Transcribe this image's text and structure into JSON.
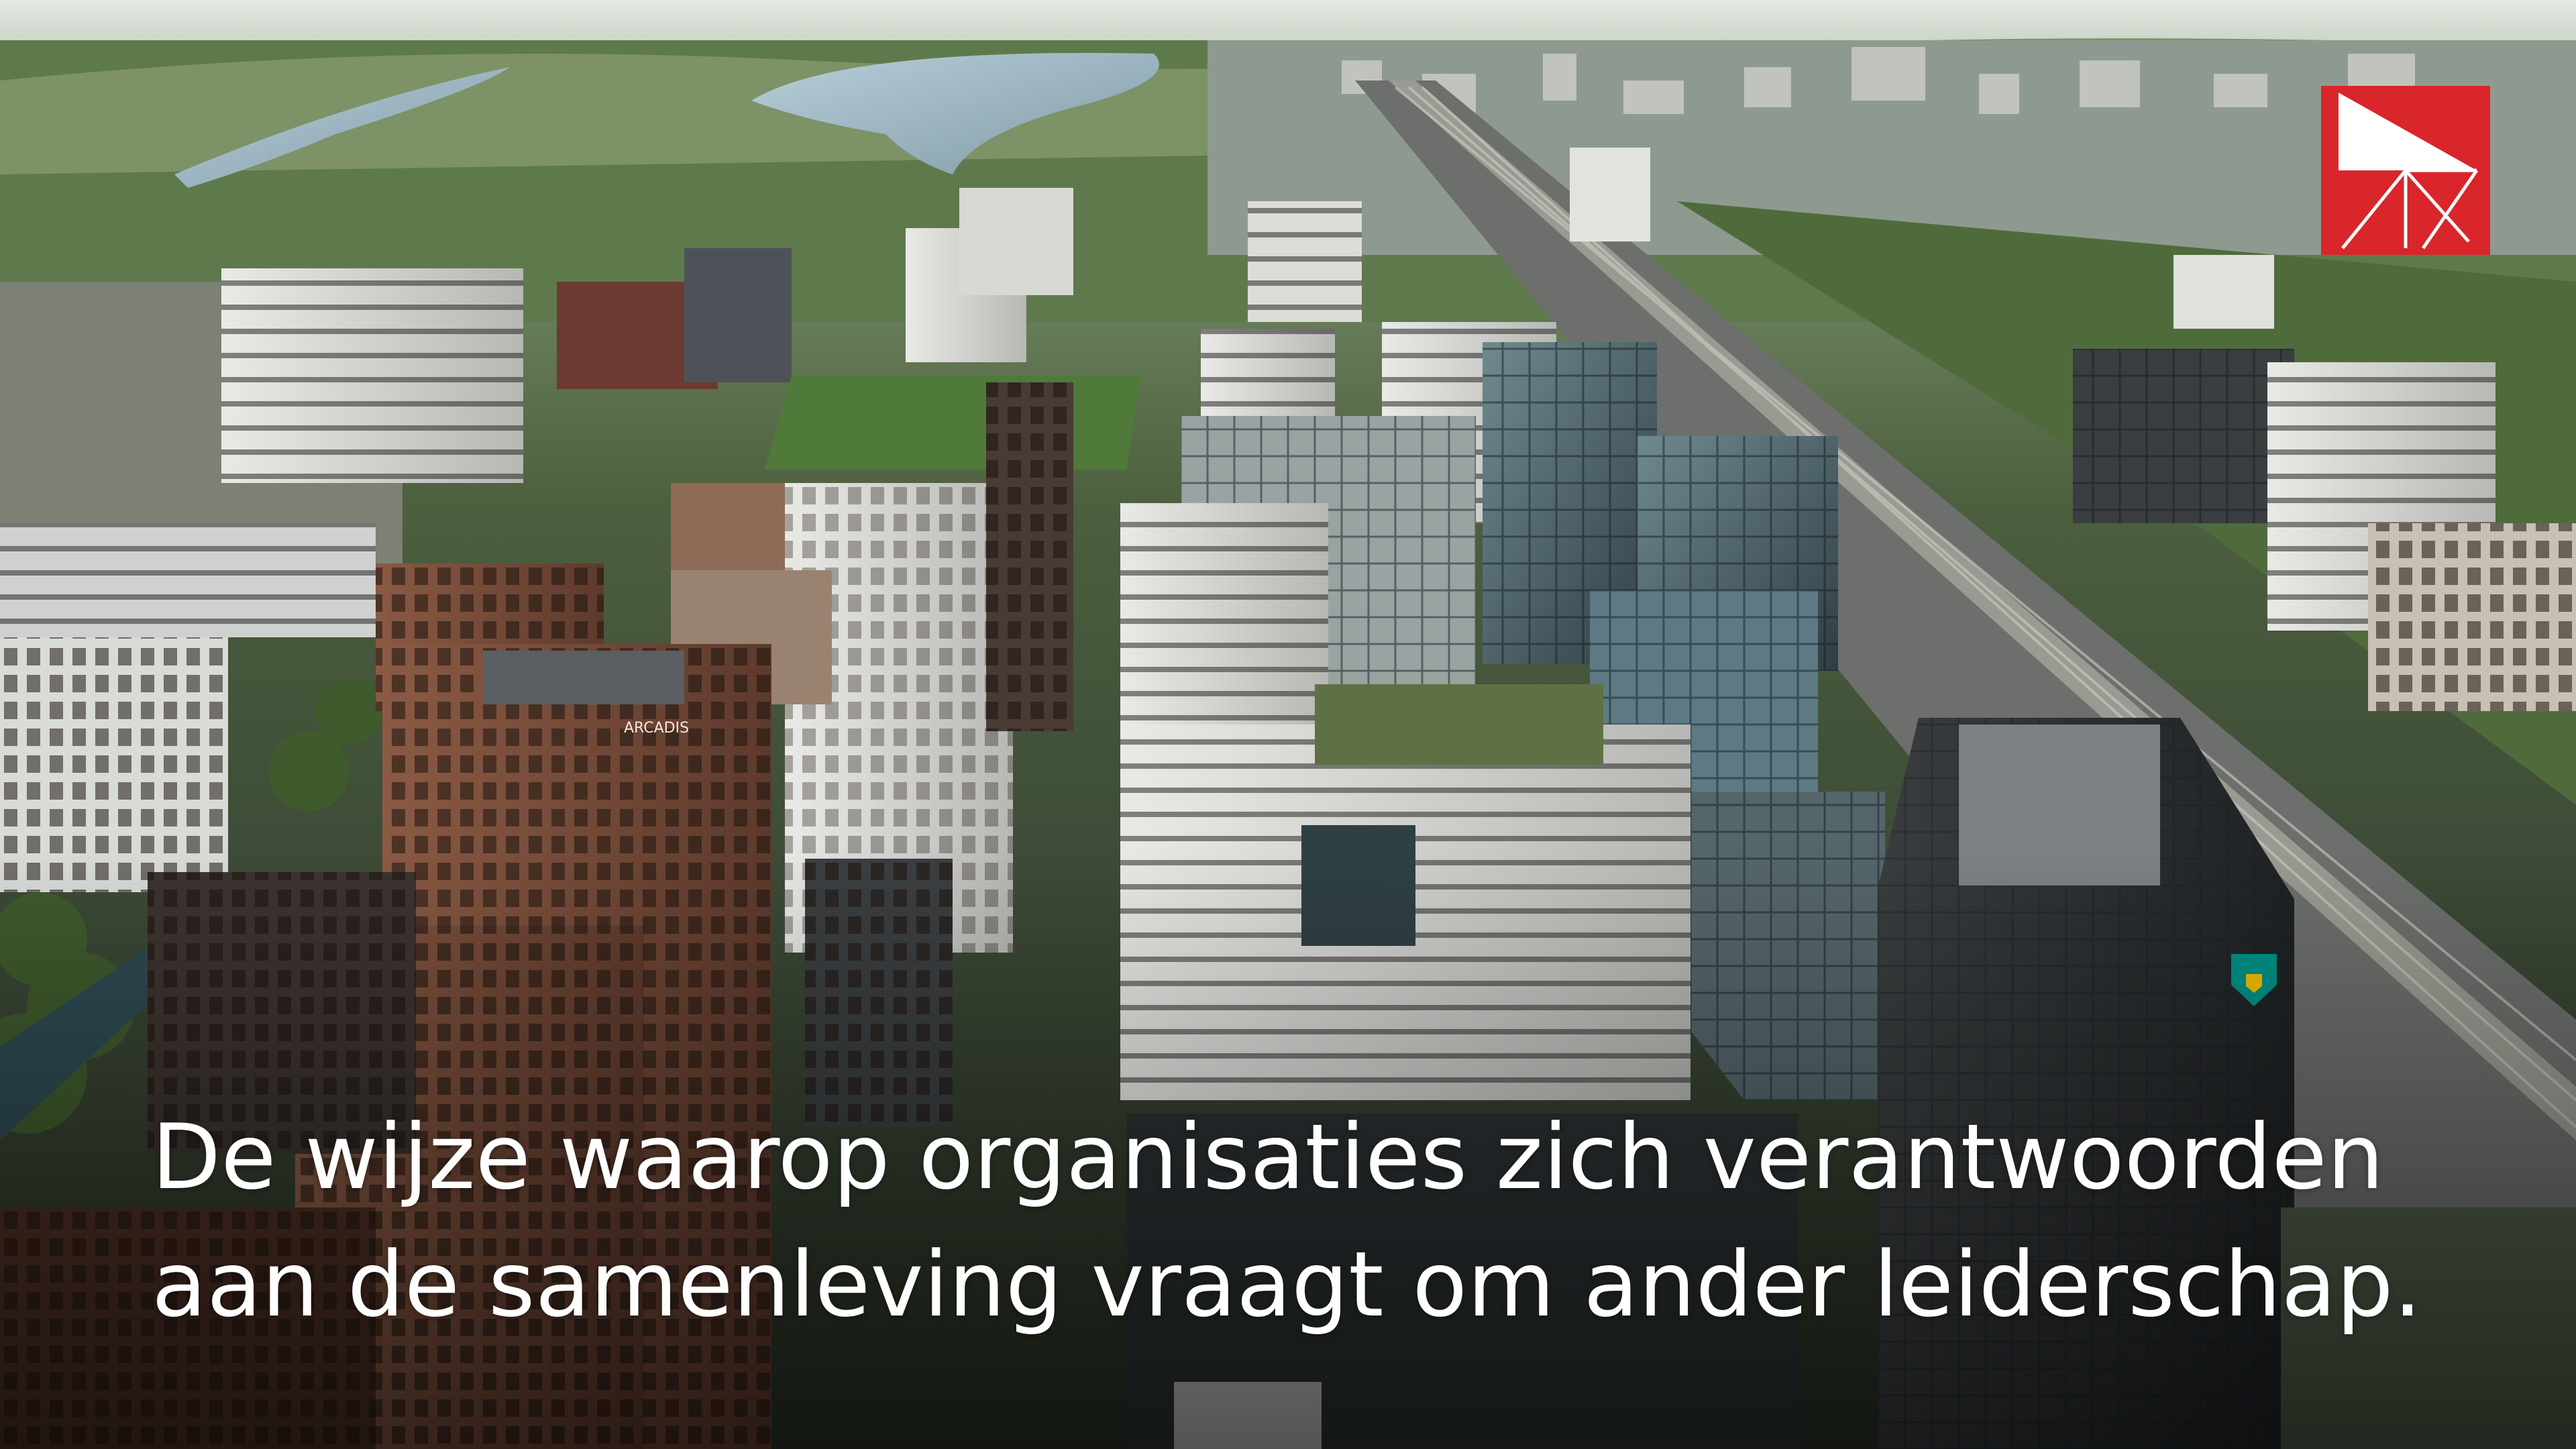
{
  "video": {
    "caption_lines": [
      "De wijze waarop organisaties zich verantwoorden",
      "aan de samenleving vraagt om ander leiderschap."
    ],
    "building_sign": "ARCADIS",
    "logo_color": "#d8262b",
    "building_logo_colors": [
      "#009286",
      "#f3c000"
    ]
  }
}
